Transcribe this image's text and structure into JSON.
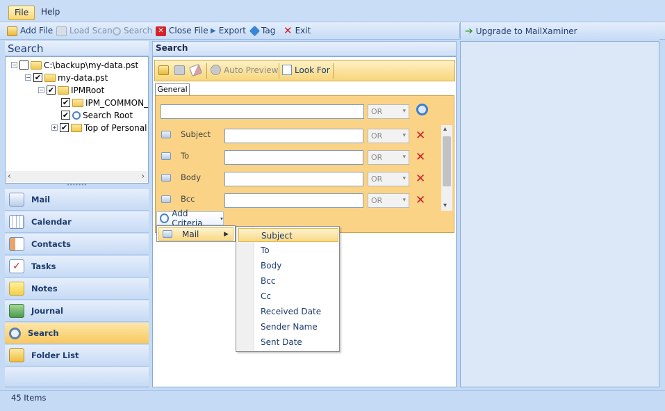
{
  "menubar": {
    "file": "File",
    "help": "Help"
  },
  "toolbar": {
    "add_file": "Add File",
    "load_scan": "Load Scan",
    "search": "Search",
    "close_file": "Close File",
    "export": "Export",
    "tag": "Tag",
    "exit": "Exit",
    "upgrade": "Upgrade to MailXaminer"
  },
  "left": {
    "title": "Search",
    "tree": [
      {
        "label": "C:\\backup\\my-data.pst"
      },
      {
        "label": "my-data.pst"
      },
      {
        "label": "IPMRoot"
      },
      {
        "label": "IPM_COMMON_"
      },
      {
        "label": "Search Root"
      },
      {
        "label": "Top of Personal F"
      }
    ],
    "nav": [
      {
        "label": "Mail"
      },
      {
        "label": "Calendar"
      },
      {
        "label": "Contacts"
      },
      {
        "label": "Tasks"
      },
      {
        "label": "Notes"
      },
      {
        "label": "Journal"
      },
      {
        "label": "Search"
      },
      {
        "label": "Folder List"
      }
    ]
  },
  "search": {
    "title": "Search",
    "auto_preview": "Auto Preview",
    "look_for": "Look For",
    "tab_general": "General",
    "operator": "OR",
    "criteria": [
      {
        "label": "Subject",
        "value": ""
      },
      {
        "label": "To",
        "value": ""
      },
      {
        "label": "Body",
        "value": ""
      },
      {
        "label": "Bcc",
        "value": ""
      }
    ],
    "add_criteria": "Add Criteria",
    "menu_mail": "Mail",
    "submenu": [
      "Subject",
      "To",
      "Body",
      "Bcc",
      "Cc",
      "Received Date",
      "Sender Name",
      "Sent Date"
    ]
  },
  "status": {
    "items": "45 Items"
  }
}
